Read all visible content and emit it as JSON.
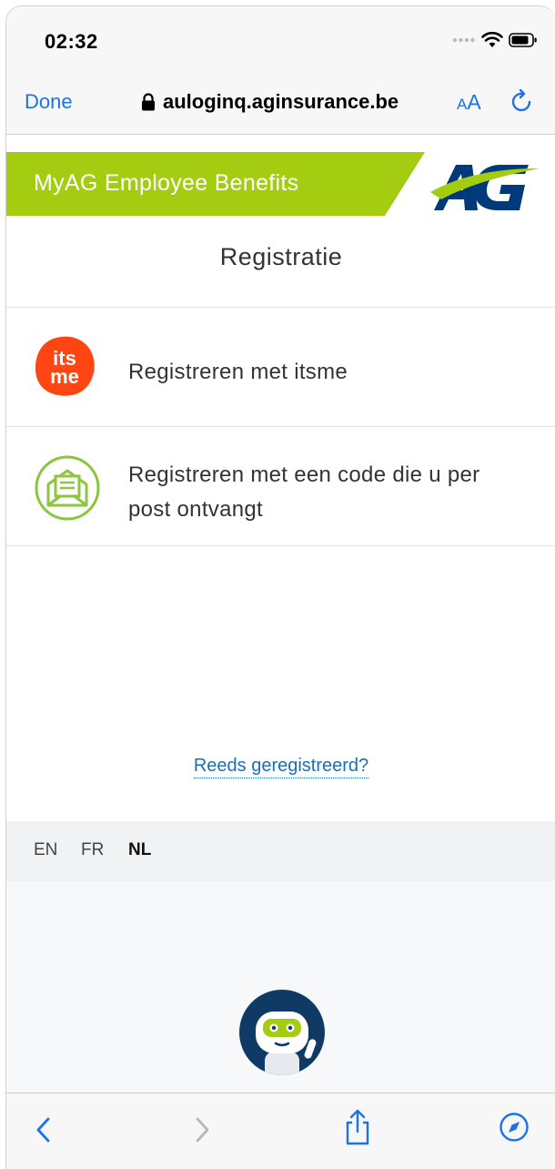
{
  "status_bar": {
    "time": "02:32"
  },
  "browser": {
    "done_label": "Done",
    "url": "auloginq.aginsurance.be",
    "text_size_small": "A",
    "text_size_large": "A"
  },
  "banner": {
    "title": "MyAG Employee Benefits",
    "brand_green": "#a4cd12",
    "brand_navy": "#003a7a"
  },
  "page": {
    "heading": "Registratie",
    "options": [
      {
        "label": "Registreren met itsme",
        "icon": "itsme-icon"
      },
      {
        "label_lines": [
          "Registreren met een code die u per",
          "post ontvangt"
        ],
        "icon": "mail-envelope-icon"
      }
    ],
    "already_registered_link": "Reeds geregistreerd?"
  },
  "itsme": {
    "top": "its",
    "bottom": "me",
    "color": "#ff4612"
  },
  "languages": [
    "EN",
    "FR",
    "NL"
  ],
  "active_language": "NL",
  "toolbar": [
    "back-icon",
    "forward-icon",
    "share-icon",
    "compass-icon"
  ]
}
